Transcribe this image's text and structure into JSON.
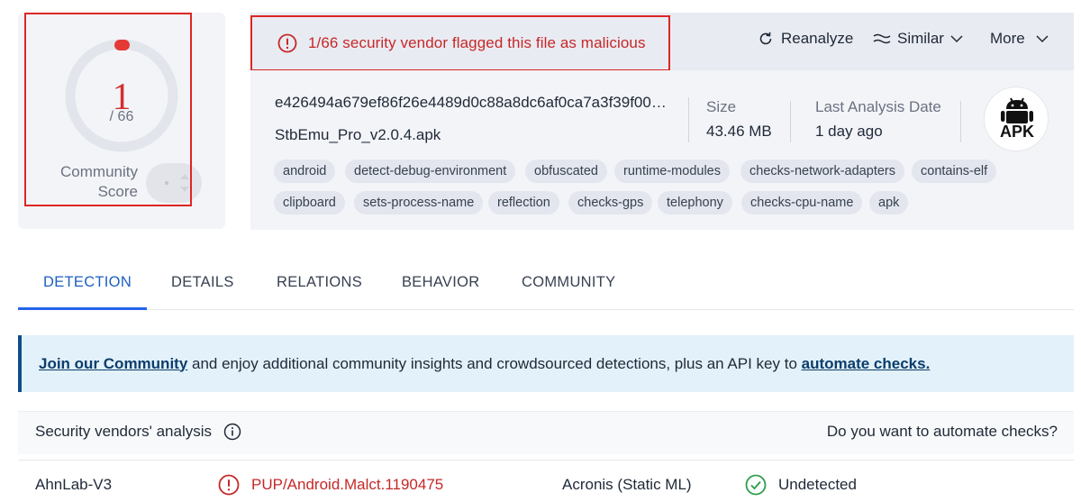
{
  "score": {
    "detections": "1",
    "total": "/ 66",
    "community_label": "Community Score",
    "detection_color": "#d32f2f"
  },
  "alert": {
    "text": "1/66 security vendor flagged this file as malicious",
    "icon": "alert-circle-icon"
  },
  "actions": {
    "reanalyze": "Reanalyze",
    "similar": "Similar",
    "more": "More"
  },
  "file": {
    "hash": "e426494a679ef86f26e4489d0c88a8dc6af0ca7a3f39f00…",
    "name": "StbEmu_Pro_v2.0.4.apk",
    "size_label": "Size",
    "size_value": "43.46 MB",
    "date_label": "Last Analysis Date",
    "date_value": "1 day ago",
    "type_badge": "APK"
  },
  "tags": [
    "android",
    "detect-debug-environment",
    "obfuscated",
    "runtime-modules",
    "checks-network-adapters",
    "contains-elf",
    "clipboard",
    "sets-process-name",
    "reflection",
    "checks-gps",
    "telephony",
    "checks-cpu-name",
    "apk"
  ],
  "tabs": [
    "DETECTION",
    "DETAILS",
    "RELATIONS",
    "BEHAVIOR",
    "COMMUNITY"
  ],
  "banner": {
    "link1": "Join our Community",
    "middle": " and enjoy additional community insights and crowdsourced detections, plus an API key to ",
    "link2": "automate checks."
  },
  "vendors": {
    "title": "Security vendors' analysis",
    "automate": "Do you want to automate checks?",
    "rows": [
      {
        "vendor1": "AhnLab-V3",
        "result1": "PUP/Android.Malct.1190475",
        "vendor2": "Acronis (Static ML)",
        "result2": "Undetected"
      }
    ]
  },
  "colors": {
    "malicious": "#c62828",
    "clean": "#2e9e4f",
    "accent": "#2563eb"
  }
}
